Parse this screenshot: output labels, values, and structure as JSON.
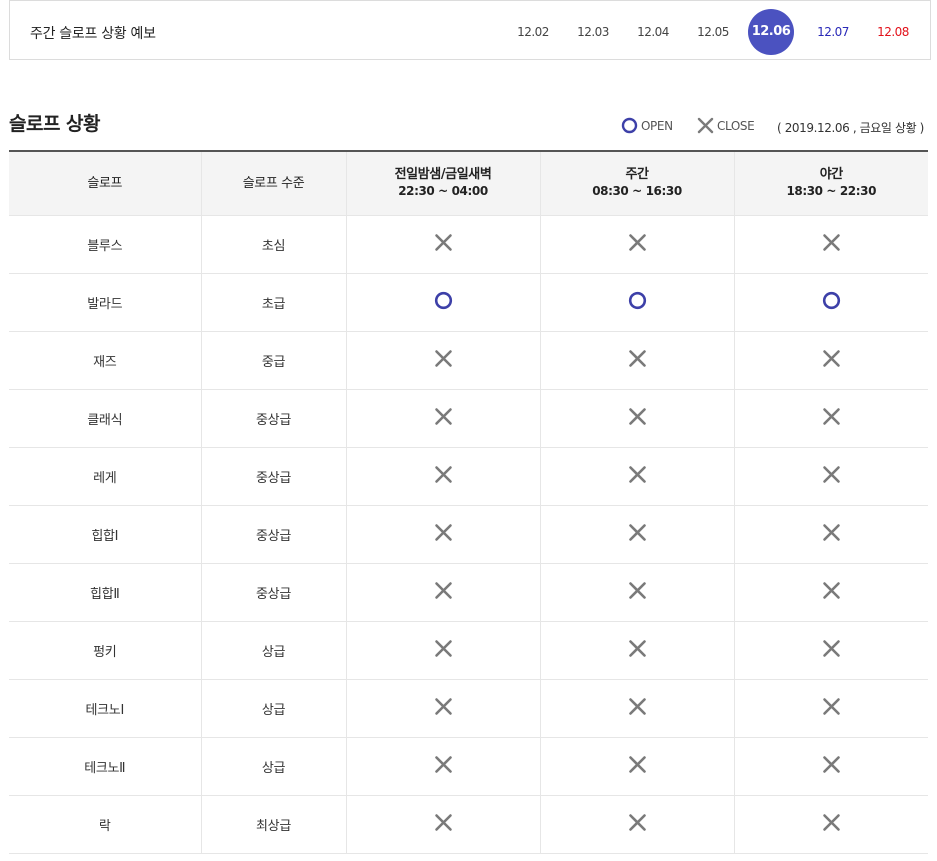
{
  "forecast": {
    "title": "주간 슬로프 상황 예보",
    "dates": [
      {
        "label": "12.02",
        "kind": "normal"
      },
      {
        "label": "12.03",
        "kind": "normal"
      },
      {
        "label": "12.04",
        "kind": "normal"
      },
      {
        "label": "12.05",
        "kind": "normal"
      },
      {
        "label": "12.06",
        "kind": "active"
      },
      {
        "label": "12.07",
        "kind": "sat"
      },
      {
        "label": "12.08",
        "kind": "sun"
      }
    ]
  },
  "section": {
    "title": "슬로프 상황",
    "legend_open": "OPEN",
    "legend_close": "CLOSE",
    "status_date": "( 2019.12.06 , 금요일 상황 )"
  },
  "colors": {
    "accent": "#4b52c0",
    "open_icon": "#3d40a8",
    "close_icon": "#7a7a7a",
    "saturday": "#2a2ab8",
    "sunday": "#e2121b"
  },
  "table": {
    "headers": {
      "slope": "슬로프",
      "level": "슬로프 수준",
      "night_title": "전일밤샘/금일새벽",
      "night_time": "22:30 ~ 04:00",
      "day_title": "주간",
      "day_time": "08:30 ~ 16:30",
      "evening_title": "야간",
      "evening_time": "18:30 ~ 22:30"
    },
    "rows": [
      {
        "slope": "블루스",
        "level": "초심",
        "night": "close",
        "day": "close",
        "evening": "close"
      },
      {
        "slope": "발라드",
        "level": "초급",
        "night": "open",
        "day": "open",
        "evening": "open"
      },
      {
        "slope": "재즈",
        "level": "중급",
        "night": "close",
        "day": "close",
        "evening": "close"
      },
      {
        "slope": "클래식",
        "level": "중상급",
        "night": "close",
        "day": "close",
        "evening": "close"
      },
      {
        "slope": "레게",
        "level": "중상급",
        "night": "close",
        "day": "close",
        "evening": "close"
      },
      {
        "slope": "힙합Ⅰ",
        "level": "중상급",
        "night": "close",
        "day": "close",
        "evening": "close"
      },
      {
        "slope": "힙합Ⅱ",
        "level": "중상급",
        "night": "close",
        "day": "close",
        "evening": "close"
      },
      {
        "slope": "펑키",
        "level": "상급",
        "night": "close",
        "day": "close",
        "evening": "close"
      },
      {
        "slope": "테크노Ⅰ",
        "level": "상급",
        "night": "close",
        "day": "close",
        "evening": "close"
      },
      {
        "slope": "테크노Ⅱ",
        "level": "상급",
        "night": "close",
        "day": "close",
        "evening": "close"
      },
      {
        "slope": "락",
        "level": "최상급",
        "night": "close",
        "day": "close",
        "evening": "close"
      }
    ]
  }
}
